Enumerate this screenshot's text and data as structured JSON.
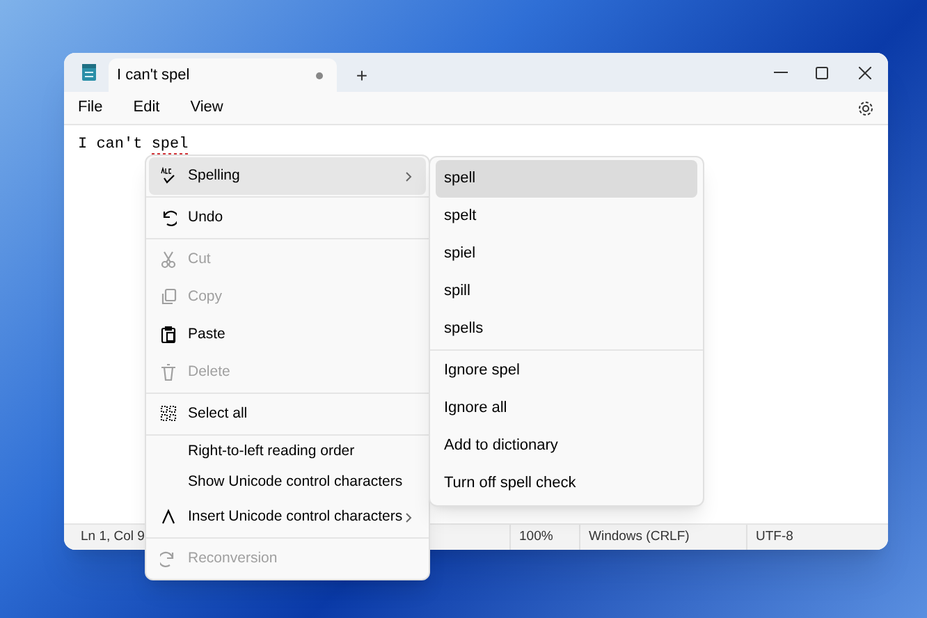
{
  "tab": {
    "title": "I can't spel",
    "modified": true,
    "new_tab": "+"
  },
  "menu_bar": [
    "File",
    "Edit",
    "View"
  ],
  "document": [
    {
      "text": "I can't ",
      "misspelled": false
    },
    {
      "text": "spel",
      "misspelled": true
    }
  ],
  "context_menu": [
    {
      "kind": "item",
      "label": "Spelling",
      "selected": true,
      "disabled": false,
      "submenu": true
    },
    {
      "kind": "separator"
    },
    {
      "kind": "item",
      "label": "Undo",
      "selected": false,
      "disabled": false,
      "submenu": false
    },
    {
      "kind": "separator"
    },
    {
      "kind": "item",
      "label": "Cut",
      "selected": false,
      "disabled": true,
      "submenu": false
    },
    {
      "kind": "item",
      "label": "Copy",
      "selected": false,
      "disabled": true,
      "submenu": false
    },
    {
      "kind": "item",
      "label": "Paste",
      "selected": false,
      "disabled": false,
      "submenu": false
    },
    {
      "kind": "item",
      "label": "Delete",
      "selected": false,
      "disabled": true,
      "submenu": false
    },
    {
      "kind": "separator"
    },
    {
      "kind": "item",
      "label": "Select all",
      "selected": false,
      "disabled": false,
      "submenu": false
    },
    {
      "kind": "separator"
    },
    {
      "kind": "text",
      "label": "Right-to-left reading order",
      "selected": false,
      "disabled": false,
      "submenu": false
    },
    {
      "kind": "text",
      "label": "Show Unicode control characters",
      "selected": false,
      "disabled": false,
      "submenu": false
    },
    {
      "kind": "item",
      "label": "Insert Unicode control characters",
      "selected": false,
      "disabled": false,
      "submenu": true
    },
    {
      "kind": "separator"
    },
    {
      "kind": "item",
      "label": "Reconversion",
      "selected": false,
      "disabled": true,
      "submenu": false
    }
  ],
  "spelling_menu": [
    {
      "kind": "item",
      "label": "spell",
      "selected": true
    },
    {
      "kind": "item",
      "label": "spelt",
      "selected": false
    },
    {
      "kind": "item",
      "label": "spiel",
      "selected": false
    },
    {
      "kind": "item",
      "label": "spill",
      "selected": false
    },
    {
      "kind": "item",
      "label": "spells",
      "selected": false
    },
    {
      "kind": "separator"
    },
    {
      "kind": "item",
      "label": "Ignore spel",
      "selected": false
    },
    {
      "kind": "item",
      "label": "Ignore all",
      "selected": false
    },
    {
      "kind": "item",
      "label": "Add to dictionary",
      "selected": false
    },
    {
      "kind": "item",
      "label": "Turn off spell check",
      "selected": false
    }
  ],
  "status_bar": {
    "position": "Ln 1, Col 9",
    "zoom": "100%",
    "line_endings": "Windows (CRLF)",
    "encoding": "UTF-8"
  }
}
